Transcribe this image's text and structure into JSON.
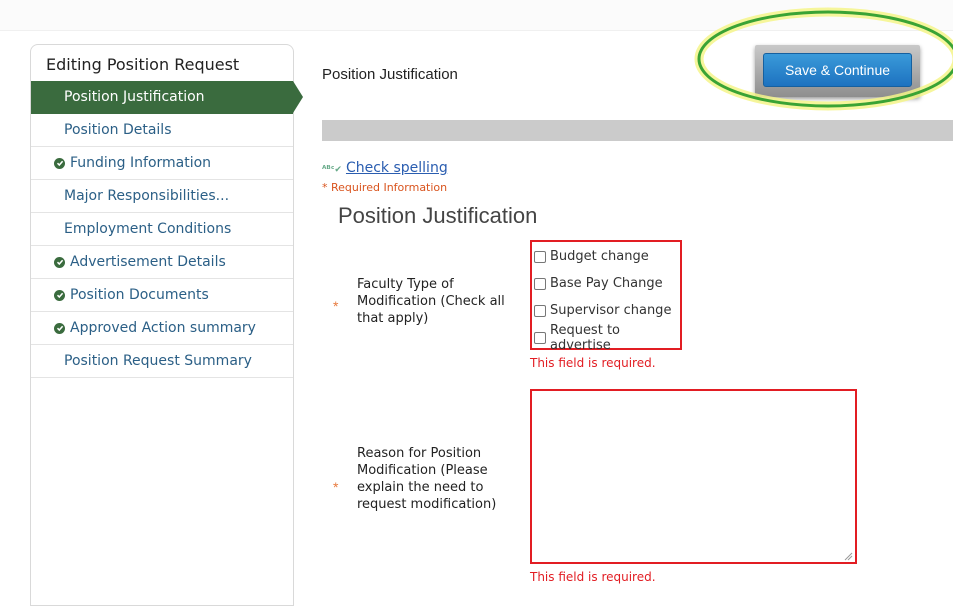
{
  "sidebar": {
    "title": "Editing Position Request",
    "items": [
      {
        "label": "Position Justification",
        "active": true,
        "checked": false
      },
      {
        "label": "Position Details",
        "active": false,
        "checked": false
      },
      {
        "label": "Funding Information",
        "active": false,
        "checked": true
      },
      {
        "label": "Major Responsibilities...",
        "active": false,
        "checked": false
      },
      {
        "label": "Employment Conditions",
        "active": false,
        "checked": false
      },
      {
        "label": "Advertisement Details",
        "active": false,
        "checked": true
      },
      {
        "label": "Position Documents",
        "active": false,
        "checked": true
      },
      {
        "label": "Approved Action summary",
        "active": false,
        "checked": true
      },
      {
        "label": "Position Request Summary",
        "active": false,
        "checked": false
      }
    ]
  },
  "main": {
    "header": "Position Justification",
    "save_label": "Save & Continue",
    "spell_check": "Check spelling",
    "required_info": "* Required Information",
    "section_title": "Position Justification",
    "field1": {
      "label_lines": [
        "Faculty Type of",
        "Modification (Check all",
        "that apply)"
      ],
      "options": [
        "Budget change",
        "Base Pay Change",
        "Supervisor change",
        "Request to advertise"
      ],
      "error": "This field is required."
    },
    "field2": {
      "label_lines": [
        "Reason for Position",
        "Modification (Please",
        "explain the need to",
        "request modification)"
      ],
      "value": "",
      "error": "This field is required."
    }
  },
  "colors": {
    "nav_active": "#3a6b3e",
    "nav_link": "#2b5f86",
    "error": "#e21d23",
    "required_star": "#e87a3d",
    "save_button": "#2383cc",
    "highlight_ellipse": "#3aa335"
  }
}
